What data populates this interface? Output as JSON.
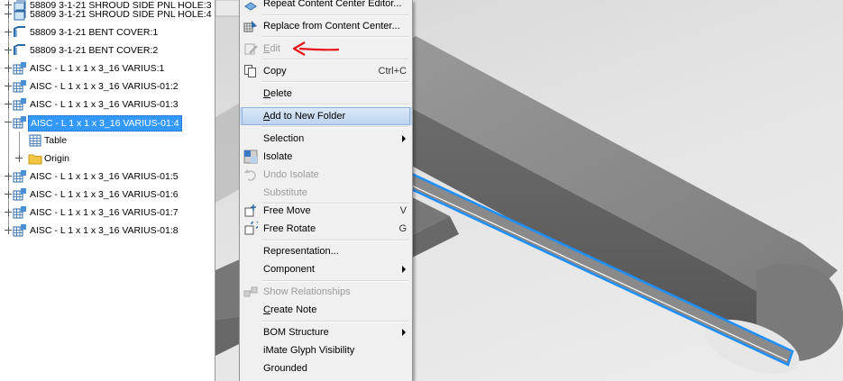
{
  "tree": {
    "items": [
      {
        "label": "58809 3-1-21 SHROUD SIDE PNL HOLE:4"
      },
      {
        "label": "58809 3-1-21 BENT COVER:1"
      },
      {
        "label": "58809 3-1-21 BENT COVER:2"
      },
      {
        "label": "AISC - L 1 x 1 x 3_16 VARIUS:1"
      },
      {
        "label": "AISC - L 1 x 1 x 3_16 VARIUS-01:2"
      },
      {
        "label": "AISC - L 1 x 1 x 3_16 VARIUS-01:3"
      },
      {
        "label": "AISC - L 1 x 1 x 3_16 VARIUS-01:4"
      },
      {
        "label": "Table"
      },
      {
        "label": "Origin"
      },
      {
        "label": "AISC - L 1 x 1 x 3_16 VARIUS-01:5"
      },
      {
        "label": "AISC - L 1 x 1 x 3_16 VARIUS-01:6"
      },
      {
        "label": "AISC - L 1 x 1 x 3_16 VARIUS-01:7"
      },
      {
        "label": "AISC - L 1 x 1 x 3_16 VARIUS-01:8"
      }
    ]
  },
  "menu": {
    "repeat": "Repeat Content Center Editor...",
    "replace": "Replace from Content Center...",
    "edit": "Edit",
    "copy": "Copy",
    "copy_sc": "Ctrl+C",
    "delete": "Delete",
    "add_folder": "Add to New Folder",
    "selection": "Selection",
    "isolate": "Isolate",
    "undo_isolate": "Undo Isolate",
    "substitute": "Substitute",
    "free_move": "Free Move",
    "free_move_sc": "V",
    "free_rotate": "Free Rotate",
    "free_rotate_sc": "G",
    "representation": "Representation...",
    "component": "Component",
    "show_rel": "Show Relationships",
    "create_note": "Create Note",
    "bom": "BOM Structure",
    "imate": "iMate Glyph Visibility",
    "grounded": "Grounded"
  },
  "colors": {
    "selection": "#3399ff",
    "highlight_edge": "#1e8fff",
    "annotation_arrow": "#e8141b"
  }
}
